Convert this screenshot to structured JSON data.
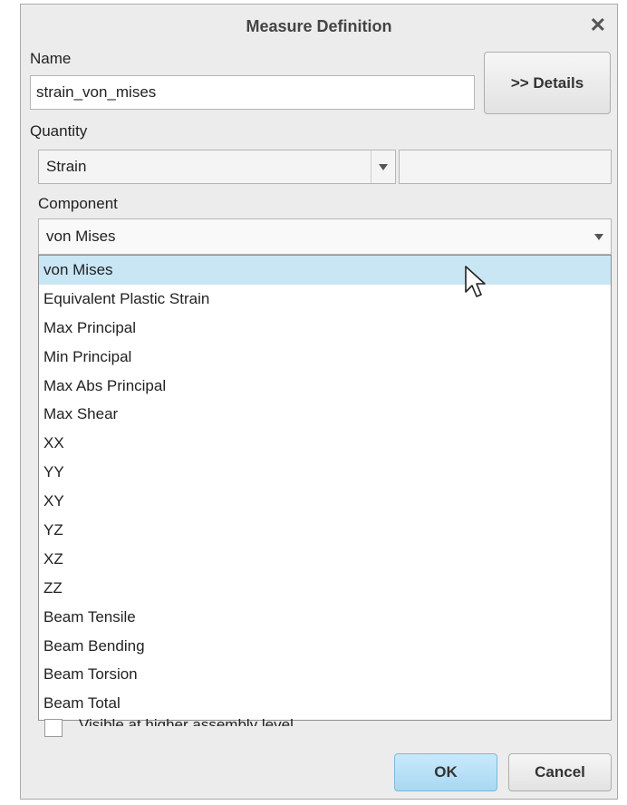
{
  "dialog": {
    "title": "Measure Definition",
    "close_glyph": "✕"
  },
  "name": {
    "label": "Name",
    "value": "strain_von_mises"
  },
  "details_button": ">> Details",
  "quantity": {
    "label": "Quantity",
    "selected": "Strain",
    "units_value": ""
  },
  "component": {
    "label": "Component",
    "selected": "von Mises",
    "options": [
      "von Mises",
      "Equivalent Plastic Strain",
      "Max Principal",
      "Min Principal",
      "Max Abs Principal",
      "Max Shear",
      "XX",
      "YY",
      "XY",
      "YZ",
      "XZ",
      "ZZ",
      "Beam Tensile",
      "Beam Bending",
      "Beam Torsion",
      "Beam Total"
    ]
  },
  "visible_checkbox": {
    "label": "Visible at higher assembly level",
    "checked": false
  },
  "footer": {
    "ok_label": "OK",
    "cancel_label": "Cancel"
  },
  "colors": {
    "selected_row": "#c9e6f5",
    "ok_button": "#b7e0f6",
    "dialog_bg": "#ececec"
  },
  "icons": {
    "close": "close-icon",
    "dropdown": "chevron-down-icon",
    "cursor": "mouse-pointer-icon"
  }
}
